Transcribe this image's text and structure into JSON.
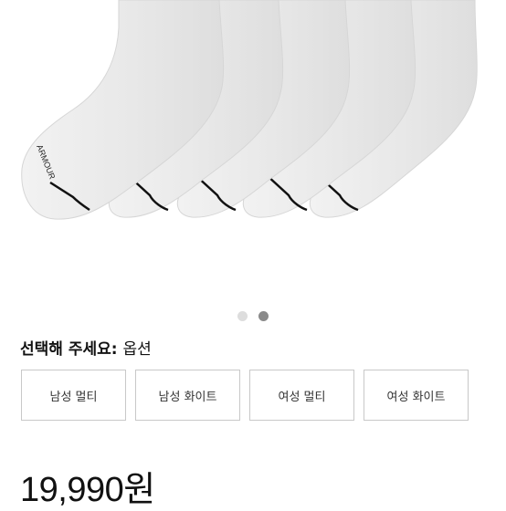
{
  "product": {
    "image_alt": "white socks 5 pack",
    "logo_text": "UNDER ARMOUR"
  },
  "carousel": {
    "total": 2,
    "active_index": 1
  },
  "options": {
    "prompt": "선택해 주세요:",
    "type": "옵션",
    "items": [
      {
        "label": "남성 멀티"
      },
      {
        "label": "남성 화이트"
      },
      {
        "label": "여성 멀티"
      },
      {
        "label": "여성 화이트"
      }
    ]
  },
  "price": "19,990원",
  "colors": {
    "dot_inactive": "#dddddd",
    "dot_active": "#8a8a8a",
    "border": "#c8c8c8"
  }
}
